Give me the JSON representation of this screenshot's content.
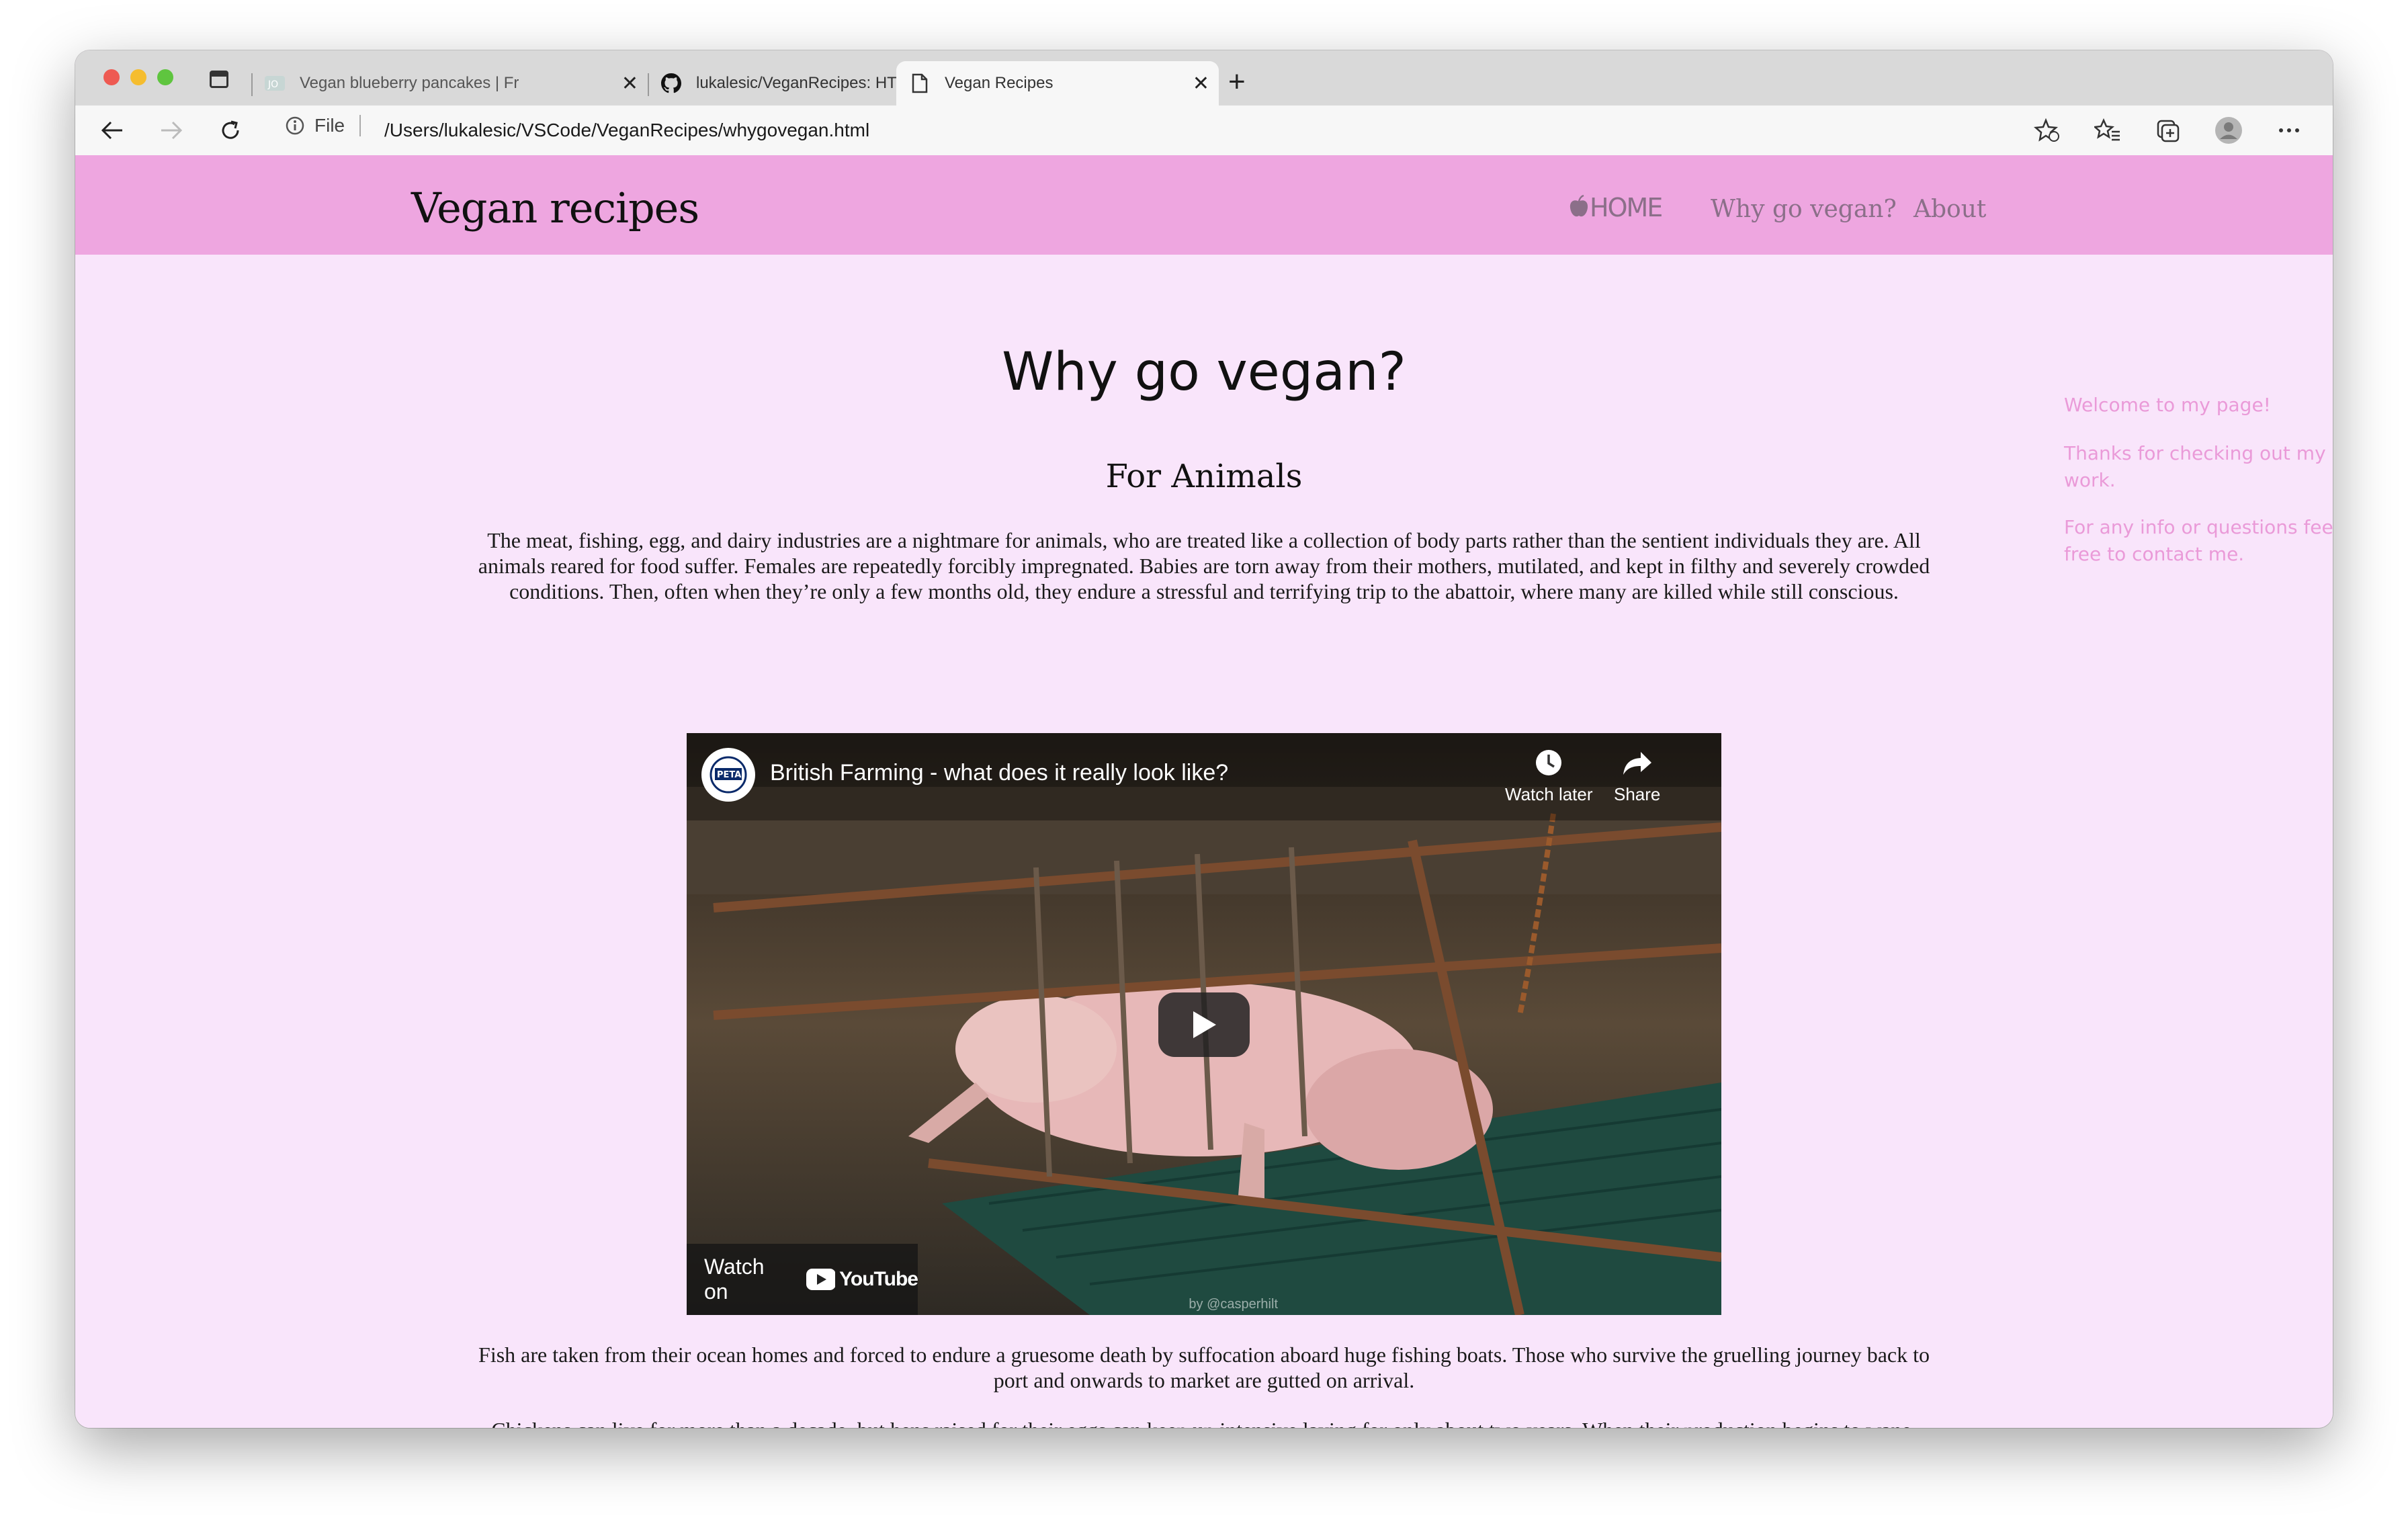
{
  "browser": {
    "tabs": [
      {
        "title": "Vegan blueberry pancakes | Fr",
        "icon": "jo-favicon"
      },
      {
        "title": "lukalesic/VeganRecipes: HTML",
        "icon": "github-icon"
      },
      {
        "title": "Vegan Recipes",
        "icon": "page-icon"
      }
    ],
    "address": {
      "scheme_label": "File",
      "url": "/Users/lukalesic/VSCode/VeganRecipes/whygovegan.html"
    }
  },
  "site": {
    "brand": "Vegan recipes",
    "nav": {
      "home": "HOME",
      "why": "Why go vegan?",
      "about": "About"
    }
  },
  "page": {
    "title": "Why go vegan?",
    "section_heading": "For Animals",
    "paragraphs": [
      "The meat, fishing, egg, and dairy industries are a nightmare for animals, who are treated like a collection of body parts rather than the sentient individuals they are. All animals reared for food suffer. Females are repeatedly forcibly impregnated. Babies are torn away from their mothers, mutilated, and kept in filthy and severely crowded conditions. Then, often when they’re only a few months old, they endure a stressful and terrifying trip to the abattoir, where many are killed while still conscious.",
      "Fish are taken from their ocean homes and forced to endure a gruesome death by suffocation aboard huge fishing boats. Those who survive the gruelling journey back to port and onwards to market are gutted on arrival.",
      "Chickens can live for more than a decade, but hens raised for their eggs can keep up intensive laying for only about two years. When their production begins to wane, they’re shipped off to slaughter. Because male chicks can’t lay eggs and haven’t been bred to produce excessive flesh for meat, they’re regarded as"
    ],
    "aside": [
      "Welcome to my page!",
      "Thanks for checking out my work.",
      "For any info or questions feel free to contact me."
    ]
  },
  "video": {
    "title": "British Farming - what does it really look like?",
    "channel_logo": "PETA",
    "watch_later": "Watch later",
    "share": "Share",
    "watch_on": "Watch on",
    "youtube": "YouTube",
    "credit": "by @casperhilt"
  },
  "colors": {
    "header": "#eea6e0",
    "page_bg": "#f9e5fb",
    "aside_text": "#ea9ad8",
    "nav_text": "#8b6f89"
  }
}
